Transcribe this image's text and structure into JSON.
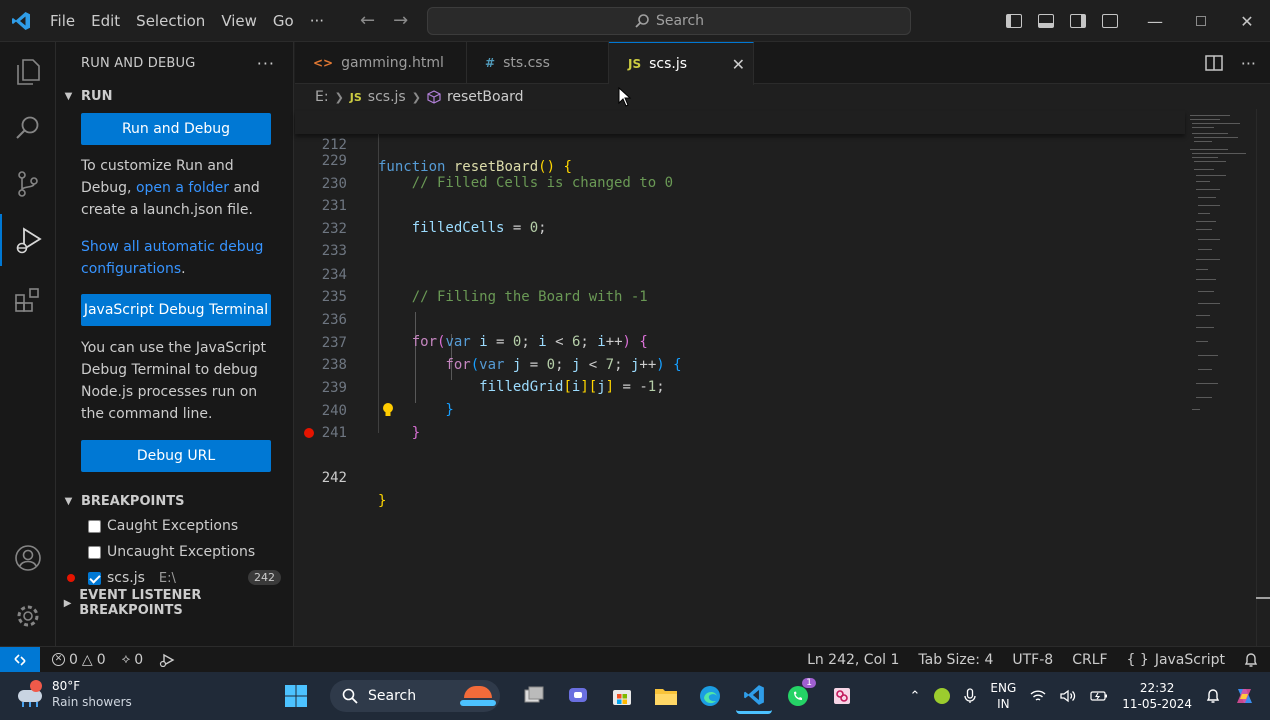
{
  "menu": [
    "File",
    "Edit",
    "Selection",
    "View",
    "Go",
    "···"
  ],
  "search": {
    "label": "Search"
  },
  "sidebar": {
    "title": "RUN AND DEBUG",
    "run_section": "RUN",
    "run_button": "Run and Debug",
    "customize_pre": "To customize Run and Debug,",
    "customize_link": "open a folder",
    "customize_post": "and create a launch.json file.",
    "show_all_link": "Show all automatic debug configurations",
    "show_all_suffix": ".",
    "js_terminal_button": "JavaScript Debug Terminal",
    "terminal_text": "You can use the JavaScript Debug Terminal to debug Node.js processes run on the command line.",
    "debug_url_button": "Debug URL",
    "breakpoints_section": "BREAKPOINTS",
    "breakpoints": [
      {
        "label": "Caught Exceptions",
        "checked": false
      },
      {
        "label": "Uncaught Exceptions",
        "checked": false
      },
      {
        "label": "scs.js",
        "path": "E:\\",
        "line": "242",
        "checked": true
      }
    ],
    "event_listener_section": "EVENT LISTENER BREAKPOINTS"
  },
  "tabs": [
    {
      "label": "gamming.html",
      "icon": "<>",
      "icon_color": "#e37933"
    },
    {
      "label": "sts.css",
      "icon": "#",
      "icon_color": "#519aba"
    },
    {
      "label": "scs.js",
      "icon": "JS",
      "icon_color": "#cbcb41",
      "active": true
    }
  ],
  "breadcrumb": {
    "drive": "E:",
    "file": "scs.js",
    "symbol": "resetBoard"
  },
  "editor": {
    "sticky": {
      "number": "212",
      "text": "function resetBoard() {"
    },
    "lines": [
      {
        "number": "229",
        "text": "    // Filled Cells is changed to 0"
      },
      {
        "number": "230",
        "text": ""
      },
      {
        "number": "231",
        "text": "    filledCells = 0;"
      },
      {
        "number": "232",
        "text": ""
      },
      {
        "number": "233",
        "text": ""
      },
      {
        "number": "234",
        "text": "    // Filling the Board with -1"
      },
      {
        "number": "235",
        "text": ""
      },
      {
        "number": "236",
        "text": "    for(var i = 0; i < 6; i++) {"
      },
      {
        "number": "237",
        "text": "        for(var j = 0; j < 7; j++) {"
      },
      {
        "number": "238",
        "text": "            filledGrid[i][j] = -1;"
      },
      {
        "number": "239",
        "text": "        }"
      },
      {
        "number": "240",
        "text": "    }"
      },
      {
        "number": "241",
        "text": ""
      },
      {
        "number": "242",
        "text": "}"
      }
    ]
  },
  "statusbar": {
    "errors": "0",
    "warnings": "0",
    "ports": "0",
    "position": "Ln 242, Col 1",
    "tab_size": "Tab Size: 4",
    "encoding": "UTF-8",
    "eol": "CRLF",
    "language_braces": "{ }",
    "language": "JavaScript"
  },
  "taskbar": {
    "weather_temp": "80°F",
    "weather_desc": "Rain showers",
    "search_label": "Search",
    "lang_top": "ENG",
    "lang_bottom": "IN",
    "time": "22:32",
    "date": "11-05-2024",
    "whatsapp_badge": "1"
  },
  "colors": {
    "accent": "#0078d4",
    "breakpoint": "#e51400",
    "link": "#3794ff"
  }
}
